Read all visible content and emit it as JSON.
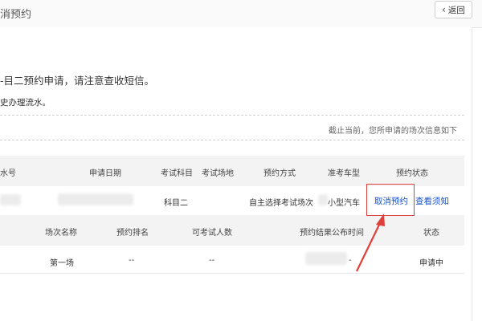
{
  "header": {
    "title": "消预约",
    "back_label": "返回"
  },
  "notice": {
    "main": "-目二预约申请，请注意查收短信。",
    "sub": "史办理流水。"
  },
  "status_line": "截止当前，您所申请的场次信息如下",
  "table1": {
    "headers": [
      "水号",
      "申请日期",
      "考试科目",
      "考试场地",
      "预约方式",
      "准考车型",
      "预约状态"
    ],
    "row": {
      "subject": "科目二",
      "method": "自主选择考试场次",
      "vehicle": "小型汽车",
      "cancel_link": "取消预约",
      "view_link": "查看须知"
    }
  },
  "table2": {
    "headers": [
      "场次名称",
      "预约排名",
      "可考试人数",
      "预约结果公布时间",
      "状态"
    ],
    "row": [
      "第一场",
      "--",
      "--",
      "-",
      "申请中"
    ]
  },
  "colors": {
    "link": "#1a53c4",
    "highlight": "#e0403a"
  }
}
